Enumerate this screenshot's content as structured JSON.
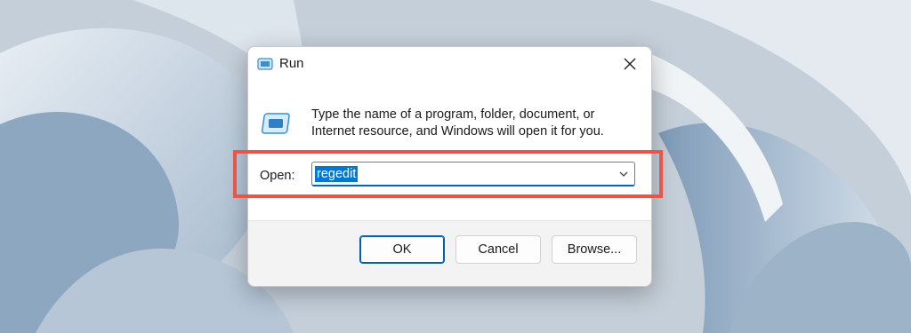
{
  "dialog": {
    "title": "Run",
    "title_icon": "run-icon",
    "close_icon": "close-icon",
    "description": "Type the name of a program, folder, document, or Internet resource, and Windows will open it for you.",
    "open_label": "Open:",
    "open_value": "regedit",
    "buttons": {
      "ok": "OK",
      "cancel": "Cancel",
      "browse": "Browse..."
    }
  },
  "annotation": {
    "highlight_color": "#e8564a"
  },
  "colors": {
    "accent": "#0078d4",
    "dialog_background": "#f3f3f3"
  }
}
